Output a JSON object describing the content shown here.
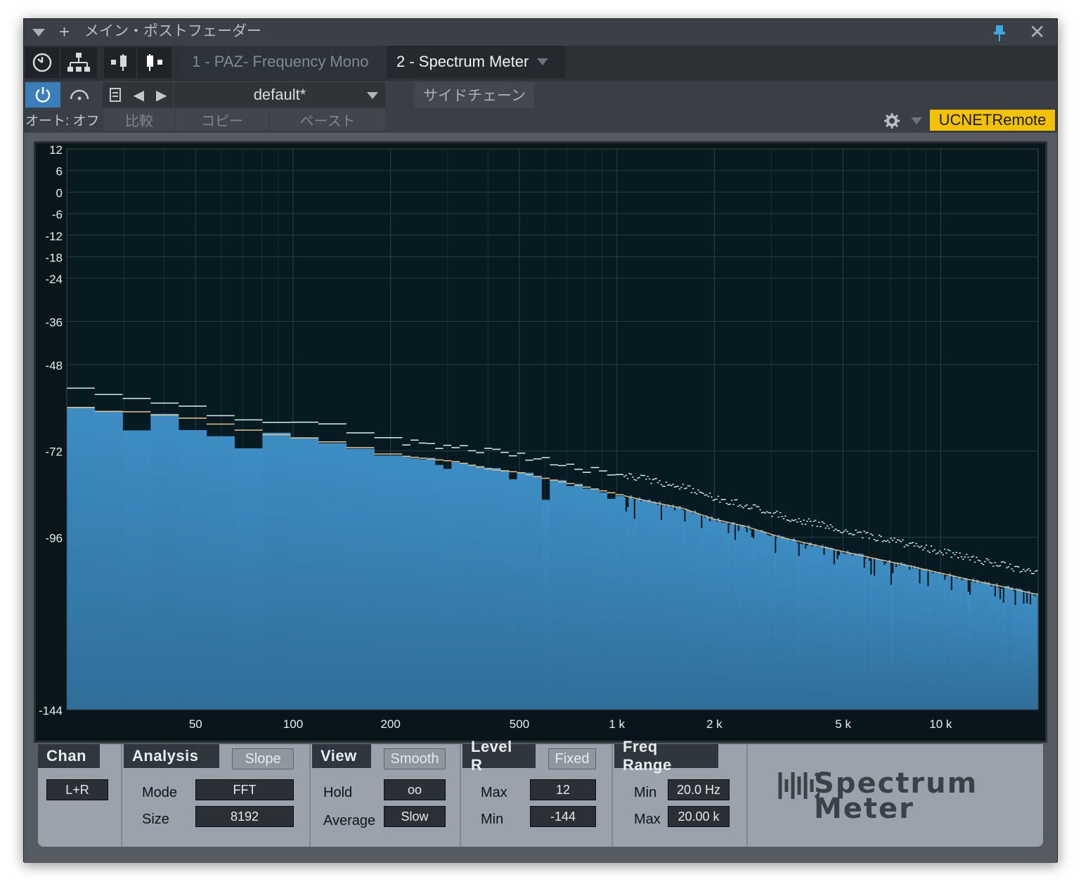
{
  "window": {
    "title": "メイン・ポストフェーダー"
  },
  "tabs": [
    {
      "label": "1 - PAZ- Frequency Mono"
    },
    {
      "label": "2 - Spectrum Meter"
    }
  ],
  "toolbar": {
    "preset": "default*",
    "sidechain": "サイドチェーン",
    "auto": "オート: オフ",
    "compare": "比較",
    "copy": "コピー",
    "paste": "ペースト",
    "remote": "UCNETRemote"
  },
  "chart_data": {
    "type": "area",
    "title": "",
    "xlabel": "",
    "ylabel": "",
    "x_scale": "log",
    "xlim": [
      20,
      20000
    ],
    "ylim": [
      -144,
      12
    ],
    "x_ticks": [
      "50",
      "100",
      "200",
      "500",
      "1 k",
      "2 k",
      "5 k",
      "10 k"
    ],
    "y_ticks": [
      "12",
      "6",
      "0",
      "-6",
      "-12",
      "-18",
      "-24",
      "-36",
      "-48",
      "-72",
      "-96",
      "-144"
    ],
    "grid": true,
    "series": [
      {
        "values_hz": [
          20,
          25,
          32,
          40,
          50,
          63,
          80,
          100,
          125,
          160,
          200,
          250,
          320,
          400,
          500,
          630,
          800,
          1000,
          1250,
          1600,
          2000,
          2500,
          3200,
          4000,
          5000,
          6300,
          8000,
          10000,
          12500,
          16000,
          20000
        ],
        "values_db": [
          -59,
          -61,
          -61,
          -62,
          -63,
          -65,
          -67,
          -68,
          -69,
          -71,
          -73,
          -74,
          -75,
          -77,
          -78,
          -80,
          -82,
          -84,
          -86,
          -88,
          -91,
          -93,
          -96,
          -98,
          -100,
          -102,
          -104,
          -106,
          -108,
          -110,
          -112
        ]
      },
      {
        "values_hz": [
          20,
          25,
          32,
          40,
          50,
          63,
          80,
          100,
          125,
          160,
          200,
          250,
          320,
          400,
          500,
          630,
          800,
          1000,
          1250,
          1600,
          2000,
          2500,
          3200,
          4000,
          5000,
          6300,
          8000,
          10000,
          12500,
          16000,
          20000
        ],
        "values_db": [
          -52,
          -56,
          -57,
          -59,
          -60,
          -62,
          -63,
          -64,
          -65,
          -67,
          -69,
          -70,
          -71,
          -72,
          -73,
          -75,
          -77,
          -78,
          -80,
          -82,
          -85,
          -87,
          -90,
          -92,
          -94,
          -96,
          -98,
          -100,
          -102,
          -104,
          -106
        ]
      }
    ]
  },
  "controls": {
    "chan": {
      "header": "Chan",
      "value": "L+R"
    },
    "analysis": {
      "header": "Analysis",
      "flag": "Slope",
      "mode_label": "Mode",
      "mode": "FFT",
      "size_label": "Size",
      "size": "8192"
    },
    "view": {
      "header": "View",
      "flag": "Smooth",
      "hold_label": "Hold",
      "hold": "oo",
      "average_label": "Average",
      "average": "Slow"
    },
    "level": {
      "header": "Level R",
      "flag": "Fixed",
      "max_label": "Max",
      "max": "12",
      "min_label": "Min",
      "min": "-144"
    },
    "freq": {
      "header": "Freq Range",
      "min_label": "Min",
      "min": "20.0 Hz",
      "max_label": "Max",
      "max": "20.00 k"
    },
    "logo_line1": "Spectrum",
    "logo_line2": "Meter"
  },
  "colors": {
    "spectrum_fill": "#3d8dc4",
    "hold_line": "#d9eef2",
    "average_line": "#e8c48a",
    "remote_bg": "#f2c200",
    "power_active": "#3a7fba"
  }
}
